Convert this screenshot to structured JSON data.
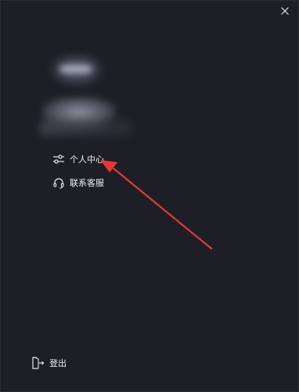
{
  "menu": {
    "items": [
      {
        "label": "个人中心",
        "icon": "sliders-icon"
      },
      {
        "label": "联系客服",
        "icon": "headset-icon"
      }
    ]
  },
  "footer": {
    "logout_label": "登出",
    "logout_icon": "logout-icon"
  },
  "window": {
    "close_icon": "close-icon"
  },
  "annotation": {
    "arrow_color": "#e53935",
    "points_to": "个人中心"
  },
  "colors": {
    "background": "#1e1f26",
    "text": "#f0f0f4"
  }
}
